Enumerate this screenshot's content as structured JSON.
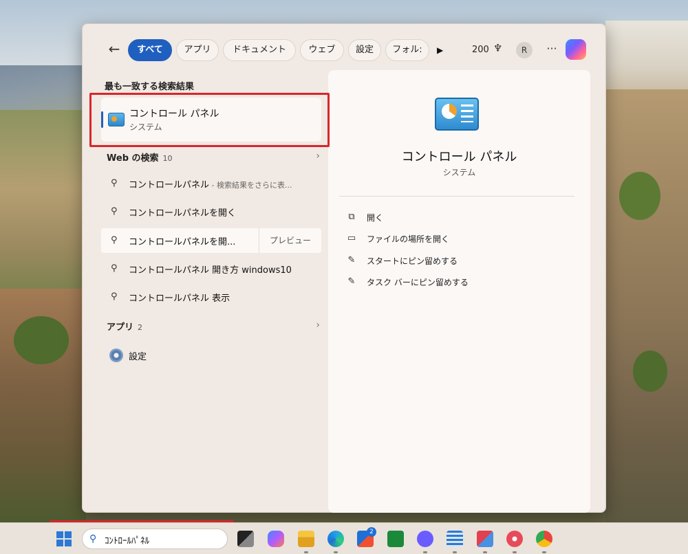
{
  "filters": {
    "back_icon": "arrow-left-icon",
    "chips": [
      {
        "label": "すべて",
        "active": true
      },
      {
        "label": "アプリ",
        "active": false
      },
      {
        "label": "ドキュメント",
        "active": false
      },
      {
        "label": "ウェブ",
        "active": false
      },
      {
        "label": "設定",
        "active": false
      },
      {
        "label": "フォル:",
        "active": false
      }
    ],
    "points": "200",
    "avatar_initial": "R",
    "more_label": "···"
  },
  "best_match": {
    "section_title": "最も一致する検索結果",
    "name": "コントロール パネル",
    "subtitle": "システム"
  },
  "web_search": {
    "title": "Web の検索",
    "count": "10",
    "results": [
      {
        "text": "コントロールパネル",
        "suffix": " - 検索結果をさらに表..."
      },
      {
        "text": "コントロールパネルを開く",
        "suffix": ""
      },
      {
        "text": "コントロールパネルを開...",
        "suffix": "",
        "preview": "プレビュー"
      },
      {
        "text": "コントロールパネル 開き方 windows10",
        "suffix": ""
      },
      {
        "text": "コントロールパネル 表示",
        "suffix": ""
      }
    ]
  },
  "apps": {
    "title": "アプリ",
    "count": "2",
    "items": [
      {
        "label": "設定",
        "icon": "gear-icon"
      }
    ]
  },
  "preview": {
    "name": "コントロール パネル",
    "subtitle": "システム",
    "actions": [
      {
        "label": "開く",
        "icon": "open-external-icon"
      },
      {
        "label": "ファイルの場所を開く",
        "icon": "folder-icon"
      },
      {
        "label": "スタートにピン留めする",
        "icon": "pin-icon"
      },
      {
        "label": "タスク バーにピン留めする",
        "icon": "pin-icon"
      }
    ]
  },
  "taskbar": {
    "search_value": "ｺﾝﾄﾛｰﾙﾊﾟﾈﾙ",
    "store_badge": "2"
  },
  "colors": {
    "accent": "#1f5fbf",
    "highlight_red": "#d7262b"
  }
}
